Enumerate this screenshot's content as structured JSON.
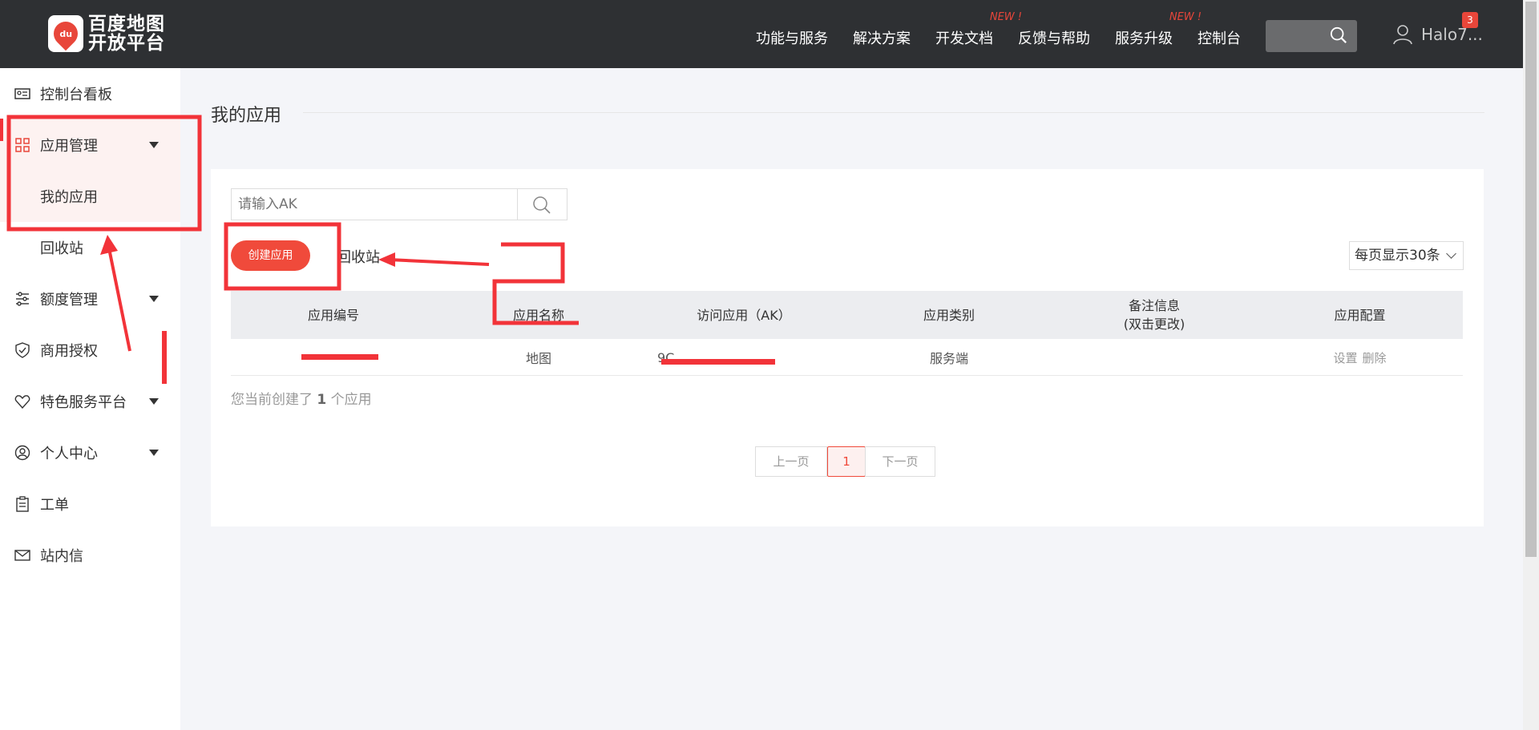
{
  "header": {
    "logo_icon_text": "du",
    "logo_line1": "百度地图",
    "logo_line2": "开放平台",
    "nav": [
      {
        "label": "功能与服务",
        "badge": ""
      },
      {
        "label": "解决方案",
        "badge": ""
      },
      {
        "label": "开发文档",
        "badge": "NEW !"
      },
      {
        "label": "反馈与帮助",
        "badge": ""
      },
      {
        "label": "服务升级",
        "badge": "NEW !"
      },
      {
        "label": "控制台",
        "badge": ""
      }
    ],
    "user_name": "Halo7...",
    "notification_count": "3"
  },
  "sidebar": {
    "items": [
      {
        "label": "控制台看板",
        "icon": "dashboard-icon"
      },
      {
        "label": "应用管理",
        "icon": "grid-icon"
      },
      {
        "label": "我的应用",
        "icon": ""
      },
      {
        "label": "回收站",
        "icon": ""
      },
      {
        "label": "额度管理",
        "icon": "sliders-icon"
      },
      {
        "label": "商用授权",
        "icon": "shield-icon"
      },
      {
        "label": "特色服务平台",
        "icon": "heart-icon"
      },
      {
        "label": "个人中心",
        "icon": "user-circle-icon"
      },
      {
        "label": "工单",
        "icon": "clipboard-icon"
      },
      {
        "label": "站内信",
        "icon": "mail-icon"
      }
    ]
  },
  "main": {
    "title": "我的应用",
    "search_placeholder": "请输入AK",
    "create_button": "创建应用",
    "recycle_link": "回收站",
    "page_size": "每页显示30条",
    "columns": [
      "应用编号",
      "应用名称",
      "访问应用（AK）",
      "应用类别",
      "备注信息\n(双击更改)",
      "应用配置"
    ],
    "row": {
      "app_id": "",
      "app_name": "地图",
      "ak_prefix": "9C",
      "category": "服务端",
      "remark": "",
      "ops": [
        "设置",
        "删除"
      ]
    },
    "count_prefix": "您当前创建了",
    "count_value": "1",
    "count_suffix": "个应用",
    "pager": {
      "prev": "上一页",
      "current": "1",
      "next": "下一页"
    }
  },
  "colors": {
    "header_bg": "#2e3033",
    "accent": "#f04a3b",
    "annotation_red": "#f23339"
  }
}
